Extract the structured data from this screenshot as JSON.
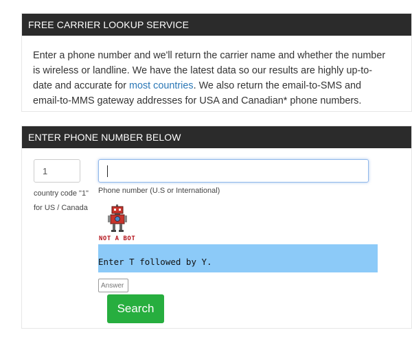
{
  "panel1": {
    "header": "FREE CARRIER LOOKUP SERVICE",
    "text_before_link": "Enter a phone number and we'll return the carrier name and whether the number is wireless or landline. We have the latest data so our results are highly up-to-date and accurate for ",
    "link": "most countries",
    "text_after_link": ". We also return the email-to-SMS and email-to-MMS gateway addresses for USA and Canadian* phone numbers."
  },
  "panel2": {
    "header": "ENTER PHONE NUMBER BELOW",
    "country_code_value": "1",
    "country_code_help": "country code \"1\" for US / Canada",
    "phone_value": "",
    "phone_label": "Phone number (U.S or International)",
    "robot_caption": "NOT A BOT",
    "captcha_prompt": "Enter T followed by Y.",
    "answer_placeholder": "Answer",
    "search_label": "Search"
  },
  "colors": {
    "header_bg": "#2b2b2b",
    "link": "#2a77b6",
    "captcha_bg": "#8ccaf8",
    "search_button": "#27ae3f"
  },
  "icons": [
    "robot-icon"
  ]
}
